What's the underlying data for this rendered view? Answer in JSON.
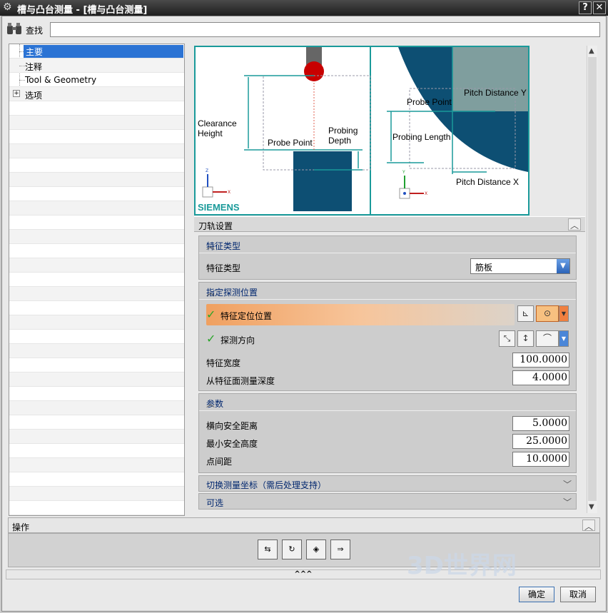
{
  "window": {
    "title": "槽与凸台测量 - [槽与凸台测量]",
    "help": "?",
    "close": "✕"
  },
  "find": {
    "label": "查找",
    "value": ""
  },
  "tree": {
    "items": [
      {
        "label": "主要"
      },
      {
        "label": "注释"
      },
      {
        "label": "Tool & Geometry"
      },
      {
        "label": "选项",
        "expand": "+"
      }
    ]
  },
  "diagram": {
    "left": {
      "clearance": "Clearance Height",
      "probe_point": "Probe Point",
      "probing_depth": "Probing Depth",
      "brand": "SIEMENS",
      "axis_z": "Z",
      "axis_x": "X"
    },
    "right": {
      "probe_point": "Probe Point",
      "pitch_y": "Pitch Distance Y",
      "probing_length": "Probing Length",
      "pitch_x": "Pitch Distance X",
      "axis_y": "Y",
      "axis_x": "X"
    }
  },
  "toolpath": {
    "title": "刀轨设置"
  },
  "feature_type": {
    "group": "特征类型",
    "label": "特征类型",
    "value": "筋板"
  },
  "probe_pos": {
    "group": "指定探测位置",
    "locate": "特征定位位置",
    "direction": "探测方向",
    "width_label": "特征宽度",
    "width": "100.0000",
    "depth_label": "从特征面测量深度",
    "depth": "4.0000"
  },
  "params": {
    "group": "参数",
    "lateral_label": "横向安全距离",
    "lateral": "5.0000",
    "min_height_label": "最小安全高度",
    "min_height": "25.0000",
    "spacing_label": "点间距",
    "spacing": "10.0000"
  },
  "switch_coord": {
    "label": "切换测量坐标（需后处理支持）"
  },
  "optional": {
    "label": "可选"
  },
  "ops": {
    "title": "操作",
    "expand": "^^^"
  },
  "buttons": {
    "ok": "确定",
    "cancel": "取消"
  },
  "watermark": {
    "text": "3D世界网"
  },
  "colors": {
    "accent": "#2b73d4",
    "teal": "#1a9a9a",
    "navy": "#0d4f73",
    "highlight": "#f0a060"
  }
}
